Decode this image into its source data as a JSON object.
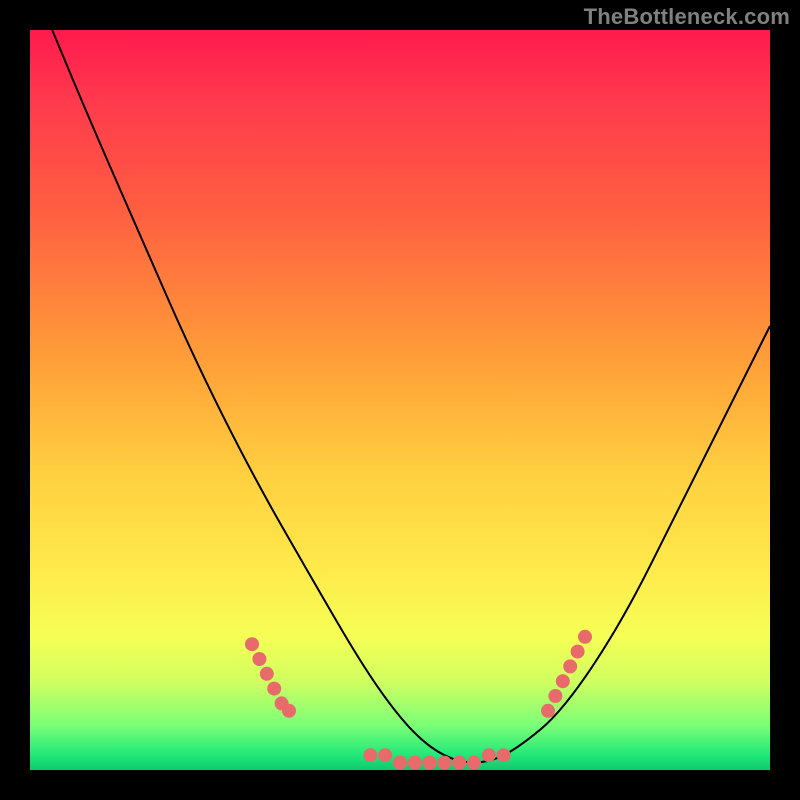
{
  "watermark": "TheBottleneck.com",
  "chart_data": {
    "type": "line",
    "title": "",
    "xlabel": "",
    "ylabel": "",
    "xlim": [
      0,
      100
    ],
    "ylim": [
      0,
      100
    ],
    "grid": false,
    "legend": false,
    "series": [
      {
        "name": "curve",
        "x": [
          3,
          8,
          15,
          22,
          30,
          38,
          45,
          50,
          54,
          58,
          62,
          66,
          72,
          80,
          88,
          96,
          100
        ],
        "y": [
          100,
          88,
          72,
          56,
          40,
          26,
          14,
          7,
          3,
          1,
          1,
          3,
          8,
          20,
          36,
          52,
          60
        ],
        "stroke": "#000000"
      }
    ],
    "markers": [
      {
        "name": "left-cluster",
        "color": "#e86a6a",
        "points": [
          {
            "x": 30,
            "y": 17
          },
          {
            "x": 31,
            "y": 15
          },
          {
            "x": 32,
            "y": 13
          },
          {
            "x": 33,
            "y": 11
          },
          {
            "x": 34,
            "y": 9
          },
          {
            "x": 35,
            "y": 8
          }
        ]
      },
      {
        "name": "bottom-cluster",
        "color": "#e86a6a",
        "points": [
          {
            "x": 46,
            "y": 2
          },
          {
            "x": 48,
            "y": 2
          },
          {
            "x": 50,
            "y": 1
          },
          {
            "x": 52,
            "y": 1
          },
          {
            "x": 54,
            "y": 1
          },
          {
            "x": 56,
            "y": 1
          },
          {
            "x": 58,
            "y": 1
          },
          {
            "x": 60,
            "y": 1
          },
          {
            "x": 62,
            "y": 2
          },
          {
            "x": 64,
            "y": 2
          }
        ]
      },
      {
        "name": "right-cluster",
        "color": "#e86a6a",
        "points": [
          {
            "x": 70,
            "y": 8
          },
          {
            "x": 71,
            "y": 10
          },
          {
            "x": 72,
            "y": 12
          },
          {
            "x": 73,
            "y": 14
          },
          {
            "x": 74,
            "y": 16
          },
          {
            "x": 75,
            "y": 18
          }
        ]
      }
    ]
  }
}
